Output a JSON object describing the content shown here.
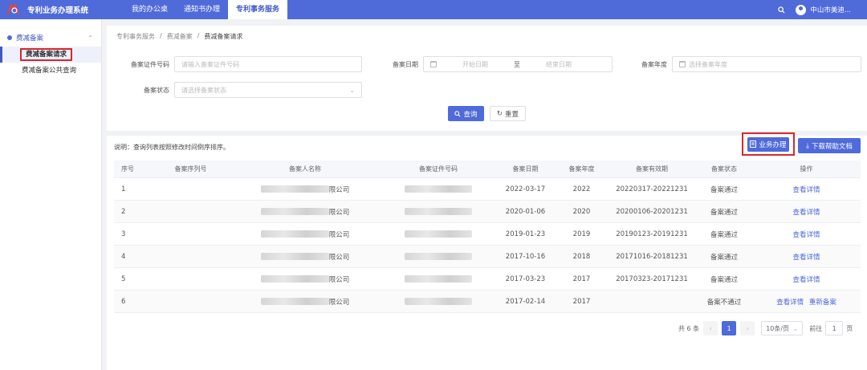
{
  "app": {
    "title": "专利业务办理系统"
  },
  "nav": [
    {
      "label": "我的办公桌"
    },
    {
      "label": "通知书办理"
    },
    {
      "label": "专利事务服务"
    }
  ],
  "user": {
    "name": "中山市美迪..."
  },
  "sidebar": {
    "group": "费减备案",
    "items": [
      {
        "label": "费减备案请求"
      },
      {
        "label": "费减备案公共查询"
      }
    ]
  },
  "breadcrumb": [
    "专利事务服务",
    "费减备案",
    "费减备案请求"
  ],
  "filters": {
    "cert_label": "备案证件号码",
    "cert_placeholder": "请输入备案证件号码",
    "date_label": "备案日期",
    "date_start": "开始日期",
    "date_sep": "至",
    "date_end": "结束日期",
    "year_label": "备案年度",
    "year_placeholder": "选择备案年度",
    "status_label": "备案状态",
    "status_placeholder": "请选择备案状态"
  },
  "buttons": {
    "query": "查询",
    "reset": "重置",
    "business": "业务办理",
    "download": "下载帮助文档"
  },
  "note": "说明：查询列表按照修改时间倒序排序。",
  "table": {
    "headers": [
      "序号",
      "备案序列号",
      "备案人名称",
      "备案证件号码",
      "备案日期",
      "备案年度",
      "备案有效期",
      "备案状态",
      "操作"
    ],
    "rows": [
      {
        "index": "1",
        "name_suffix": "限公司",
        "date": "2022-03-17",
        "year": "2022",
        "validity": "20220317-20221231",
        "status": "备案通过",
        "actions": [
          "查看详情"
        ]
      },
      {
        "index": "2",
        "name_suffix": "限公司",
        "date": "2020-01-06",
        "year": "2020",
        "validity": "20200106-20201231",
        "status": "备案通过",
        "actions": [
          "查看详情"
        ]
      },
      {
        "index": "3",
        "name_suffix": "限公司",
        "date": "2019-01-23",
        "year": "2019",
        "validity": "20190123-20191231",
        "status": "备案通过",
        "actions": [
          "查看详情"
        ]
      },
      {
        "index": "4",
        "name_suffix": "限公司",
        "date": "2017-10-16",
        "year": "2018",
        "validity": "20171016-20181231",
        "status": "备案通过",
        "actions": [
          "查看详情"
        ]
      },
      {
        "index": "5",
        "name_suffix": "限公司",
        "date": "2017-03-23",
        "year": "2017",
        "validity": "20170323-20171231",
        "status": "备案通过",
        "actions": [
          "查看详情"
        ]
      },
      {
        "index": "6",
        "name_suffix": "限公司",
        "date": "2017-02-14",
        "year": "2017",
        "validity": "",
        "status": "备案不通过",
        "actions": [
          "查看详情",
          "重新备案"
        ]
      }
    ]
  },
  "pager": {
    "total": "共 6 条",
    "page": "1",
    "page_size": "10条/页",
    "goto_label": "前往",
    "goto_value": "1",
    "page_unit": "页"
  },
  "colors": {
    "accent": "#4f6ad9",
    "highlight": "#d9262e"
  }
}
